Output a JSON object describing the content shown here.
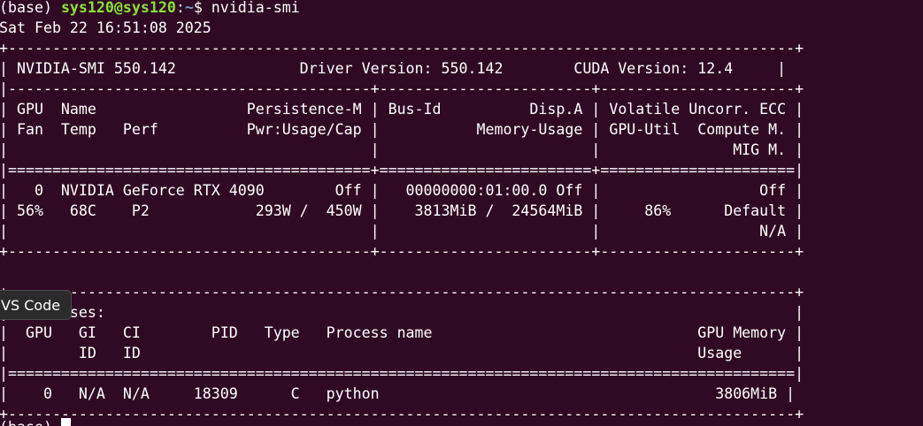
{
  "terminal": {
    "prompt": {
      "env": "(base) ",
      "user_host": "sys120@sys120",
      "separator": ":",
      "path": "~",
      "symbol": "$ ",
      "command": "nvidia-smi"
    },
    "timestamp": "Sat Feb 22 16:51:08 2025",
    "smi": {
      "border_top": "+-----------------------------------------------------------------------------------------+",
      "header_line": "| NVIDIA-SMI 550.142              Driver Version: 550.142        CUDA Version: 12.4     |",
      "sep_header": "|-----------------------------------------+------------------------+----------------------+",
      "col_header_1": "| GPU  Name                 Persistence-M | Bus-Id          Disp.A | Volatile Uncorr. ECC |",
      "col_header_2": "| Fan  Temp   Perf          Pwr:Usage/Cap |           Memory-Usage | GPU-Util  Compute M. |",
      "col_header_3": "|                                         |                        |               MIG M. |",
      "sep_double": "|=========================================+========================+======================|",
      "gpu_line_1": "|   0  NVIDIA GeForce RTX 4090        Off |   00000000:01:00.0 Off |                  Off |",
      "gpu_line_2": "| 56%   68C    P2            293W /  450W |    3813MiB /  24564MiB |     86%      Default |",
      "gpu_line_3": "|                                         |                        |                  N/A |",
      "gpu_border_bottom": "+-----------------------------------------+------------------------+----------------------+",
      "blank": " ",
      "proc_border_top": "+-----------------------------------------------------------------------------------------+",
      "proc_title": "| Processes:                                                                              |",
      "proc_header_1": "|  GPU   GI   CI        PID   Type   Process name                              GPU Memory |",
      "proc_header_2": "|        ID   ID                                                               Usage      |",
      "proc_sep": "|=========================================================================================|",
      "proc_row_1": "|    0   N/A  N/A     18309      C   python                                      3806MiB |",
      "proc_border_bottom": "+-----------------------------------------------------------------------------------------+"
    },
    "next_prompt_partial": "(base) "
  },
  "tooltip": {
    "label": "VS Code"
  },
  "colors": {
    "background": "#300a24",
    "text": "#ffffff",
    "user_host": "#8ae234",
    "path": "#729fcf"
  }
}
